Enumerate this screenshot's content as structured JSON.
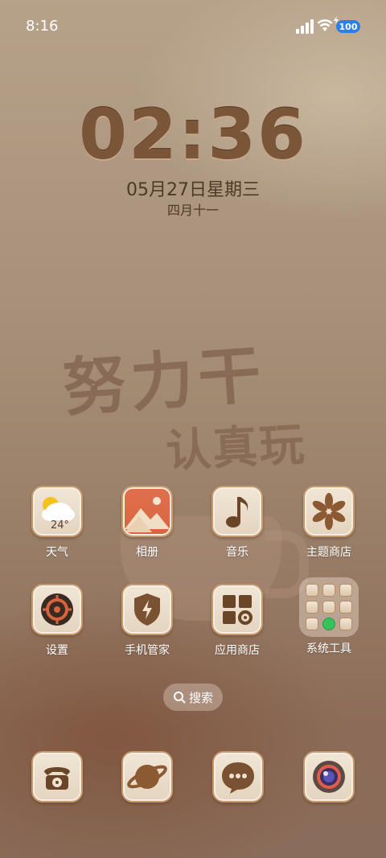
{
  "status_bar": {
    "time": "8:16",
    "battery": "100"
  },
  "lock_clock": {
    "time": "02:36",
    "date": "05月27日星期三",
    "lunar": "四月十一"
  },
  "wallpaper_text": {
    "line1": "努力干",
    "line2": "认真玩"
  },
  "apps": [
    {
      "label": "天气",
      "icon": "weather-icon",
      "temp": "24°"
    },
    {
      "label": "相册",
      "icon": "gallery-icon"
    },
    {
      "label": "音乐",
      "icon": "music-icon"
    },
    {
      "label": "主题商店",
      "icon": "theme-store-icon"
    },
    {
      "label": "设置",
      "icon": "settings-icon"
    },
    {
      "label": "手机管家",
      "icon": "phone-manager-icon"
    },
    {
      "label": "应用商店",
      "icon": "app-store-icon"
    },
    {
      "label": "系统工具",
      "icon": "system-tools-folder-icon"
    }
  ],
  "search": {
    "label": "搜索"
  },
  "dock": [
    {
      "icon": "phone-icon"
    },
    {
      "icon": "browser-icon"
    },
    {
      "icon": "messages-icon"
    },
    {
      "icon": "camera-icon"
    }
  ]
}
